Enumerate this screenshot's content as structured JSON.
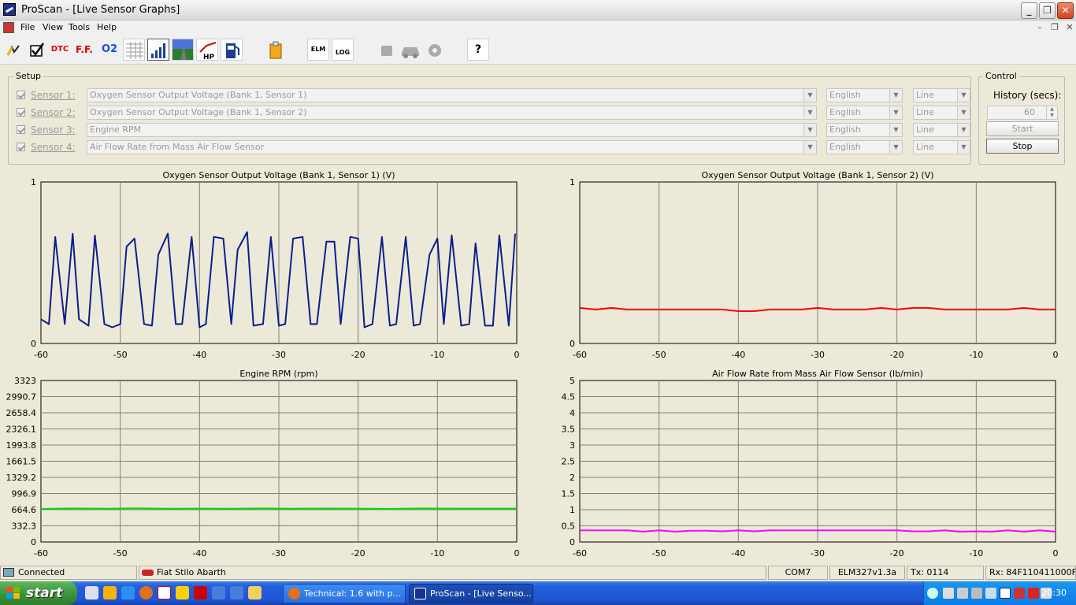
{
  "window": {
    "title": "ProScan - [Live Sensor Graphs]",
    "minimize": "_",
    "restore": "❐",
    "close": "✕"
  },
  "menu": {
    "items": [
      "File",
      "View",
      "Tools",
      "Help"
    ],
    "mdi_minimize": "–",
    "mdi_restore": "❐",
    "mdi_close": "✕"
  },
  "toolbar": {
    "buttons": [
      {
        "name": "connect-icon",
        "label": ""
      },
      {
        "name": "check-icon",
        "label": ""
      },
      {
        "name": "dtc-icon",
        "label": "DTC"
      },
      {
        "name": "freeze-frame-icon",
        "label": "F.F."
      },
      {
        "name": "oxygen-sensor-icon",
        "label": "O2"
      },
      {
        "name": "table-icon",
        "label": ""
      },
      {
        "name": "graph-icon",
        "label": ""
      },
      {
        "name": "road-icon",
        "label": ""
      },
      {
        "name": "horsepower-icon",
        "label": "HP"
      },
      {
        "name": "fuel-icon",
        "label": ""
      },
      {
        "name": "report-icon",
        "label": ""
      },
      {
        "name": "elm-icon",
        "label": "ELM"
      },
      {
        "name": "log-icon",
        "label": "LOG"
      },
      {
        "name": "engine-icon",
        "label": ""
      },
      {
        "name": "car-icon",
        "label": ""
      },
      {
        "name": "settings-icon",
        "label": ""
      },
      {
        "name": "help-icon",
        "label": "?"
      }
    ]
  },
  "setup": {
    "legend": "Setup",
    "sensors": [
      {
        "label": "Sensor 1:",
        "pid": "Oxygen Sensor Output Voltage (Bank 1, Sensor 1)",
        "units": "English",
        "style": "Line"
      },
      {
        "label": "Sensor 2:",
        "pid": "Oxygen Sensor Output Voltage (Bank 1, Sensor 2)",
        "units": "English",
        "style": "Line"
      },
      {
        "label": "Sensor 3:",
        "pid": "Engine RPM",
        "units": "English",
        "style": "Line"
      },
      {
        "label": "Sensor 4:",
        "pid": "Air Flow Rate from Mass Air Flow Sensor",
        "units": "English",
        "style": "Line"
      }
    ]
  },
  "control": {
    "legend": "Control",
    "history_label": "History (secs):",
    "history_value": "60",
    "start_label": "Start",
    "stop_label": "Stop"
  },
  "chart_data": [
    {
      "type": "line",
      "title": "Oxygen Sensor Output Voltage (Bank 1, Sensor 1) (V)",
      "ylim": [
        0,
        1
      ],
      "y_ticks": [
        "0",
        "1"
      ],
      "xlim": [
        -60,
        0
      ],
      "x_ticks": [
        "-60",
        "-50",
        "-40",
        "-30",
        "-20",
        "-10",
        "0"
      ],
      "grid": true,
      "series": [
        {
          "color": "#0a1e8c",
          "x": [
            -60,
            -59,
            -58.2,
            -57,
            -56,
            -55.2,
            -54,
            -53.2,
            -52,
            -51,
            -50,
            -49.2,
            -48.2,
            -47,
            -46,
            -45.2,
            -44,
            -43,
            -42.2,
            -41,
            -40,
            -39.2,
            -38.2,
            -37,
            -36,
            -35.2,
            -34,
            -33.2,
            -32,
            -31,
            -30,
            -29.2,
            -28.2,
            -27,
            -26,
            -25.2,
            -24,
            -23,
            -22.2,
            -21,
            -20,
            -19.2,
            -18.2,
            -17,
            -16,
            -15.2,
            -14,
            -13,
            -12.2,
            -11,
            -10,
            -9.2,
            -8.2,
            -7,
            -6,
            -5.2,
            -4,
            -3,
            -2.2,
            -1,
            -0.2
          ],
          "y": [
            0.15,
            0.12,
            0.66,
            0.12,
            0.68,
            0.15,
            0.11,
            0.67,
            0.12,
            0.1,
            0.12,
            0.6,
            0.65,
            0.12,
            0.11,
            0.55,
            0.68,
            0.12,
            0.12,
            0.66,
            0.1,
            0.12,
            0.66,
            0.65,
            0.12,
            0.58,
            0.69,
            0.11,
            0.12,
            0.66,
            0.11,
            0.12,
            0.65,
            0.66,
            0.12,
            0.12,
            0.63,
            0.63,
            0.12,
            0.66,
            0.65,
            0.1,
            0.12,
            0.66,
            0.11,
            0.12,
            0.66,
            0.11,
            0.12,
            0.55,
            0.65,
            0.12,
            0.67,
            0.11,
            0.12,
            0.62,
            0.11,
            0.11,
            0.67,
            0.11,
            0.68
          ]
        }
      ]
    },
    {
      "type": "line",
      "title": "Oxygen Sensor Output Voltage (Bank 1, Sensor 2) (V)",
      "ylim": [
        0,
        1
      ],
      "y_ticks": [
        "0",
        "1"
      ],
      "xlim": [
        -60,
        0
      ],
      "x_ticks": [
        "-60",
        "-50",
        "-40",
        "-30",
        "-20",
        "-10",
        "0"
      ],
      "grid": true,
      "series": [
        {
          "color": "#ff0000",
          "x": [
            -60,
            -58,
            -56,
            -54,
            -52,
            -50,
            -48,
            -46,
            -44,
            -42,
            -40,
            -38,
            -36,
            -34,
            -32,
            -30,
            -28,
            -26,
            -24,
            -22,
            -20,
            -18,
            -16,
            -14,
            -12,
            -10,
            -8,
            -6,
            -4,
            -2,
            0
          ],
          "y": [
            0.22,
            0.21,
            0.22,
            0.21,
            0.21,
            0.21,
            0.21,
            0.21,
            0.21,
            0.21,
            0.2,
            0.2,
            0.21,
            0.21,
            0.21,
            0.22,
            0.21,
            0.21,
            0.21,
            0.22,
            0.21,
            0.22,
            0.22,
            0.21,
            0.21,
            0.21,
            0.21,
            0.21,
            0.22,
            0.21,
            0.21
          ]
        }
      ]
    },
    {
      "type": "line",
      "title": "Engine RPM (rpm)",
      "ylim": [
        0,
        3323
      ],
      "y_ticks": [
        "0",
        "332.3",
        "664.6",
        "996.9",
        "1329.2",
        "1661.5",
        "1993.8",
        "2326.1",
        "2658.4",
        "2990.7",
        "3323"
      ],
      "xlim": [
        -60,
        0
      ],
      "x_ticks": [
        "-60",
        "-50",
        "-40",
        "-30",
        "-20",
        "-10",
        "0"
      ],
      "grid": true,
      "series": [
        {
          "color": "#00dd00",
          "x": [
            -60,
            -56,
            -52,
            -48,
            -44,
            -40,
            -36,
            -32,
            -28,
            -24,
            -20,
            -16,
            -12,
            -8,
            -4,
            0
          ],
          "y": [
            680,
            690,
            685,
            692,
            686,
            688,
            684,
            690,
            686,
            689,
            687,
            680,
            690,
            687,
            688,
            688
          ]
        }
      ]
    },
    {
      "type": "line",
      "title": "Air Flow Rate from Mass Air Flow Sensor (lb/min)",
      "ylim": [
        0,
        5
      ],
      "y_ticks": [
        "0",
        "0.5",
        "1",
        "1.5",
        "2",
        "2.5",
        "3",
        "3.5",
        "4",
        "4.5",
        "5"
      ],
      "xlim": [
        -60,
        0
      ],
      "x_ticks": [
        "-60",
        "-50",
        "-40",
        "-30",
        "-20",
        "-10",
        "0"
      ],
      "grid": true,
      "series": [
        {
          "color": "#ff00ff",
          "x": [
            -60,
            -57,
            -54,
            -52,
            -50,
            -48,
            -46,
            -44,
            -42,
            -40,
            -38,
            -36,
            -34,
            -32,
            -30,
            -28,
            -26,
            -24,
            -22,
            -20,
            -18,
            -16,
            -14,
            -12,
            -10,
            -8,
            -6,
            -4,
            -2,
            0
          ],
          "y": [
            0.36,
            0.36,
            0.36,
            0.32,
            0.36,
            0.32,
            0.35,
            0.35,
            0.33,
            0.36,
            0.33,
            0.36,
            0.36,
            0.36,
            0.36,
            0.36,
            0.36,
            0.36,
            0.36,
            0.36,
            0.33,
            0.33,
            0.36,
            0.32,
            0.33,
            0.32,
            0.36,
            0.32,
            0.36,
            0.32
          ]
        }
      ]
    }
  ],
  "status": {
    "connection": "Connected",
    "vehicle": "Fiat Stilo Abarth",
    "port": "COM7",
    "interface": "ELM327v1.3a",
    "tx": "Tx: 0114",
    "rx": "Rx: 84F110411000F"
  },
  "taskbar": {
    "start_label": "start",
    "tasks": [
      {
        "label": "Technical: 1.6 with p...",
        "active": false
      },
      {
        "label": "ProScan - [Live Senso...",
        "active": true
      }
    ],
    "clock": "20:30"
  }
}
